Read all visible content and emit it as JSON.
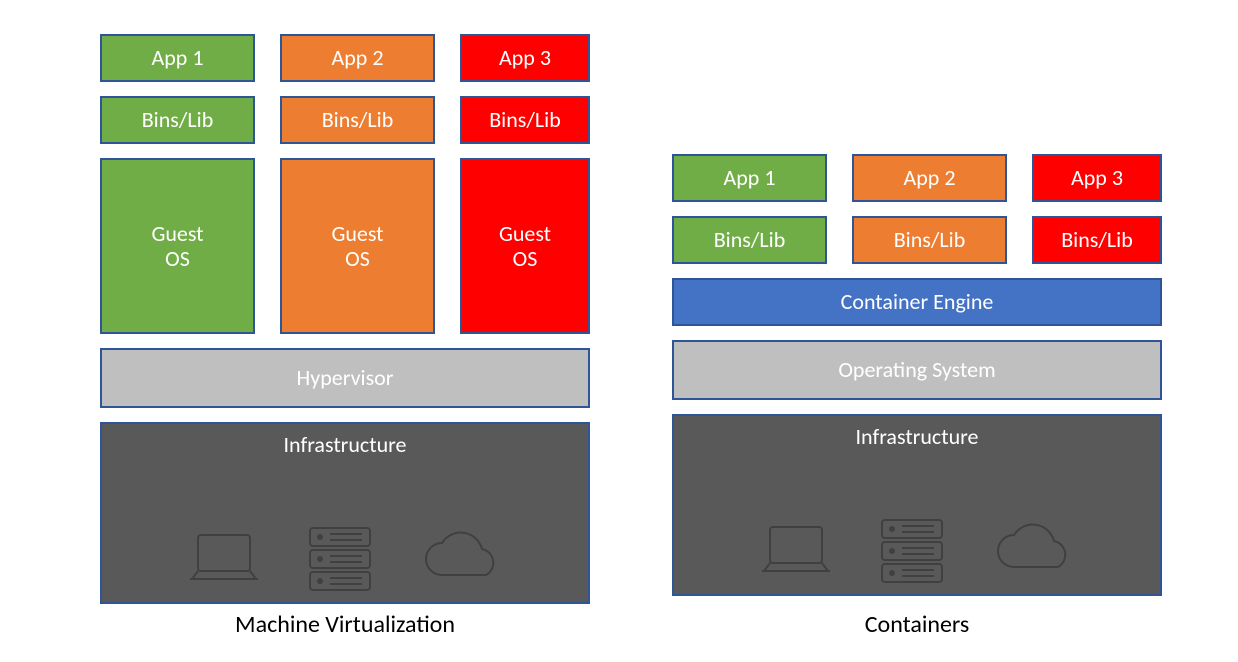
{
  "vm": {
    "caption": "Machine Virtualization",
    "cols": [
      {
        "app": "App 1",
        "bins": "Bins/Lib",
        "guest": "Guest\nOS"
      },
      {
        "app": "App 2",
        "bins": "Bins/Lib",
        "guest": "Guest\nOS"
      },
      {
        "app": "App 3",
        "bins": "Bins/Lib",
        "guest": "Guest\nOS"
      }
    ],
    "hypervisor": "Hypervisor",
    "infrastructure": "Infrastructure"
  },
  "ct": {
    "caption": "Containers",
    "cols": [
      {
        "app": "App 1",
        "bins": "Bins/Lib"
      },
      {
        "app": "App 2",
        "bins": "Bins/Lib"
      },
      {
        "app": "App 3",
        "bins": "Bins/Lib"
      }
    ],
    "engine": "Container Engine",
    "os": "Operating System",
    "infrastructure": "Infrastructure"
  },
  "colors": {
    "green": "#70AD47",
    "orange": "#ED7D31",
    "red": "#FF0000",
    "blue": "#4472C4",
    "gray_light": "#BFBFBF",
    "gray_dark": "#595959",
    "border": "#2E5597"
  }
}
